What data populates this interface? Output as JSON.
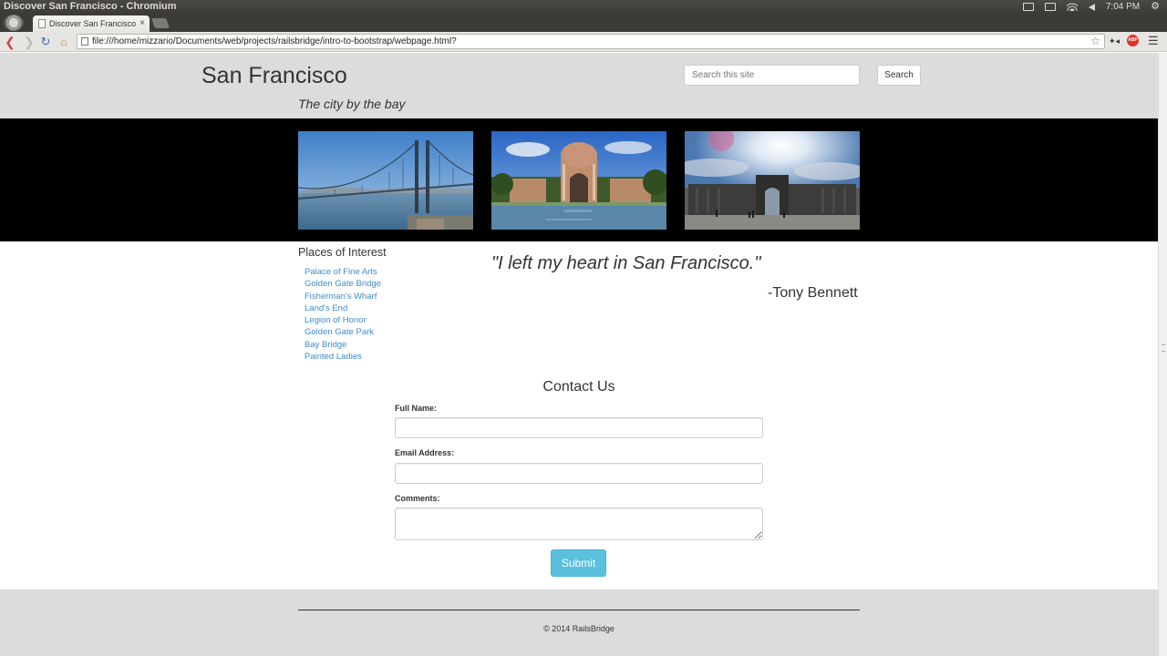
{
  "os": {
    "window_title": "Discover San Francisco - Chromium",
    "clock": "7:04 PM"
  },
  "browser": {
    "tab_title": "Discover San Francisco",
    "tab_close": "×",
    "url": "file:///home/mizzario/Documents/web/projects/railsbridge/intro-to-bootstrap/webpage.html?",
    "abp_label": "ABP",
    "ext_label": "✦◂"
  },
  "header": {
    "title": "San Francisco",
    "tagline": "The city by the bay",
    "search_placeholder": "Search this site",
    "search_button": "Search"
  },
  "places": {
    "heading": "Places of Interest",
    "items": [
      "Palace of Fine Arts",
      "Golden Gate Bridge",
      "Fisherman's Wharf",
      "Land's End",
      "Legion of Honor",
      "Golden Gate Park",
      "Bay Bridge",
      "Painted Ladies"
    ]
  },
  "quote": {
    "text": "\"I left my heart in San Francisco.\"",
    "author": "-Tony Bennett"
  },
  "contact": {
    "title": "Contact Us",
    "name_label": "Full Name:",
    "email_label": "Email Address:",
    "comments_label": "Comments:",
    "name_value": "",
    "email_value": "",
    "comments_value": "",
    "submit": "Submit"
  },
  "footer": {
    "copyright": "© 2014 RailsBridge"
  },
  "colors": {
    "link": "#428bca",
    "submit": "#5bc0de",
    "band": "#000000",
    "header_bg": "#dcdcdc"
  }
}
